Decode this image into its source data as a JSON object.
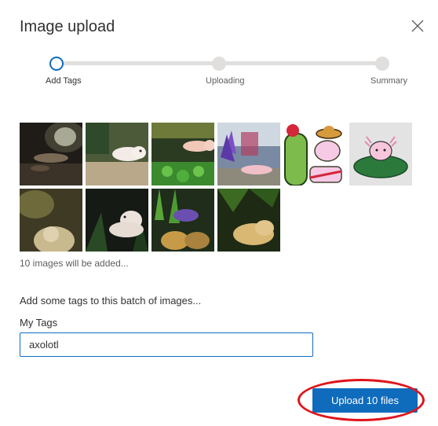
{
  "dialog": {
    "title": "Image upload",
    "close_icon": "close-icon"
  },
  "stepper": {
    "steps": [
      {
        "label": "Add Tags",
        "state": "active"
      },
      {
        "label": "Uploading",
        "state": "pending"
      },
      {
        "label": "Summary",
        "state": "pending"
      }
    ]
  },
  "images": [
    {
      "subject": "axolotl-dark-tank"
    },
    {
      "subject": "axolotl-white-sand"
    },
    {
      "subject": "axolotl-green-tank"
    },
    {
      "subject": "axolotl-purple-plants"
    },
    {
      "subject": "axolotl-cactus-cartoon"
    },
    {
      "subject": "axolotl-lilypad-cartoon"
    },
    {
      "subject": "axolotl-dark-closeup"
    },
    {
      "subject": "axolotl-white-dark"
    },
    {
      "subject": "axolotl-purple-plants-2"
    },
    {
      "subject": "axolotl-yellow-dark"
    }
  ],
  "count_text": "10 images will be added...",
  "tags": {
    "prompt": "Add some tags to this batch of images...",
    "label": "My Tags",
    "value": "axolotl"
  },
  "upload_button": {
    "label": "Upload 10 files"
  },
  "colors": {
    "accent": "#0f6cbd",
    "highlight": "#e0141b",
    "track": "#e1dfdd"
  }
}
